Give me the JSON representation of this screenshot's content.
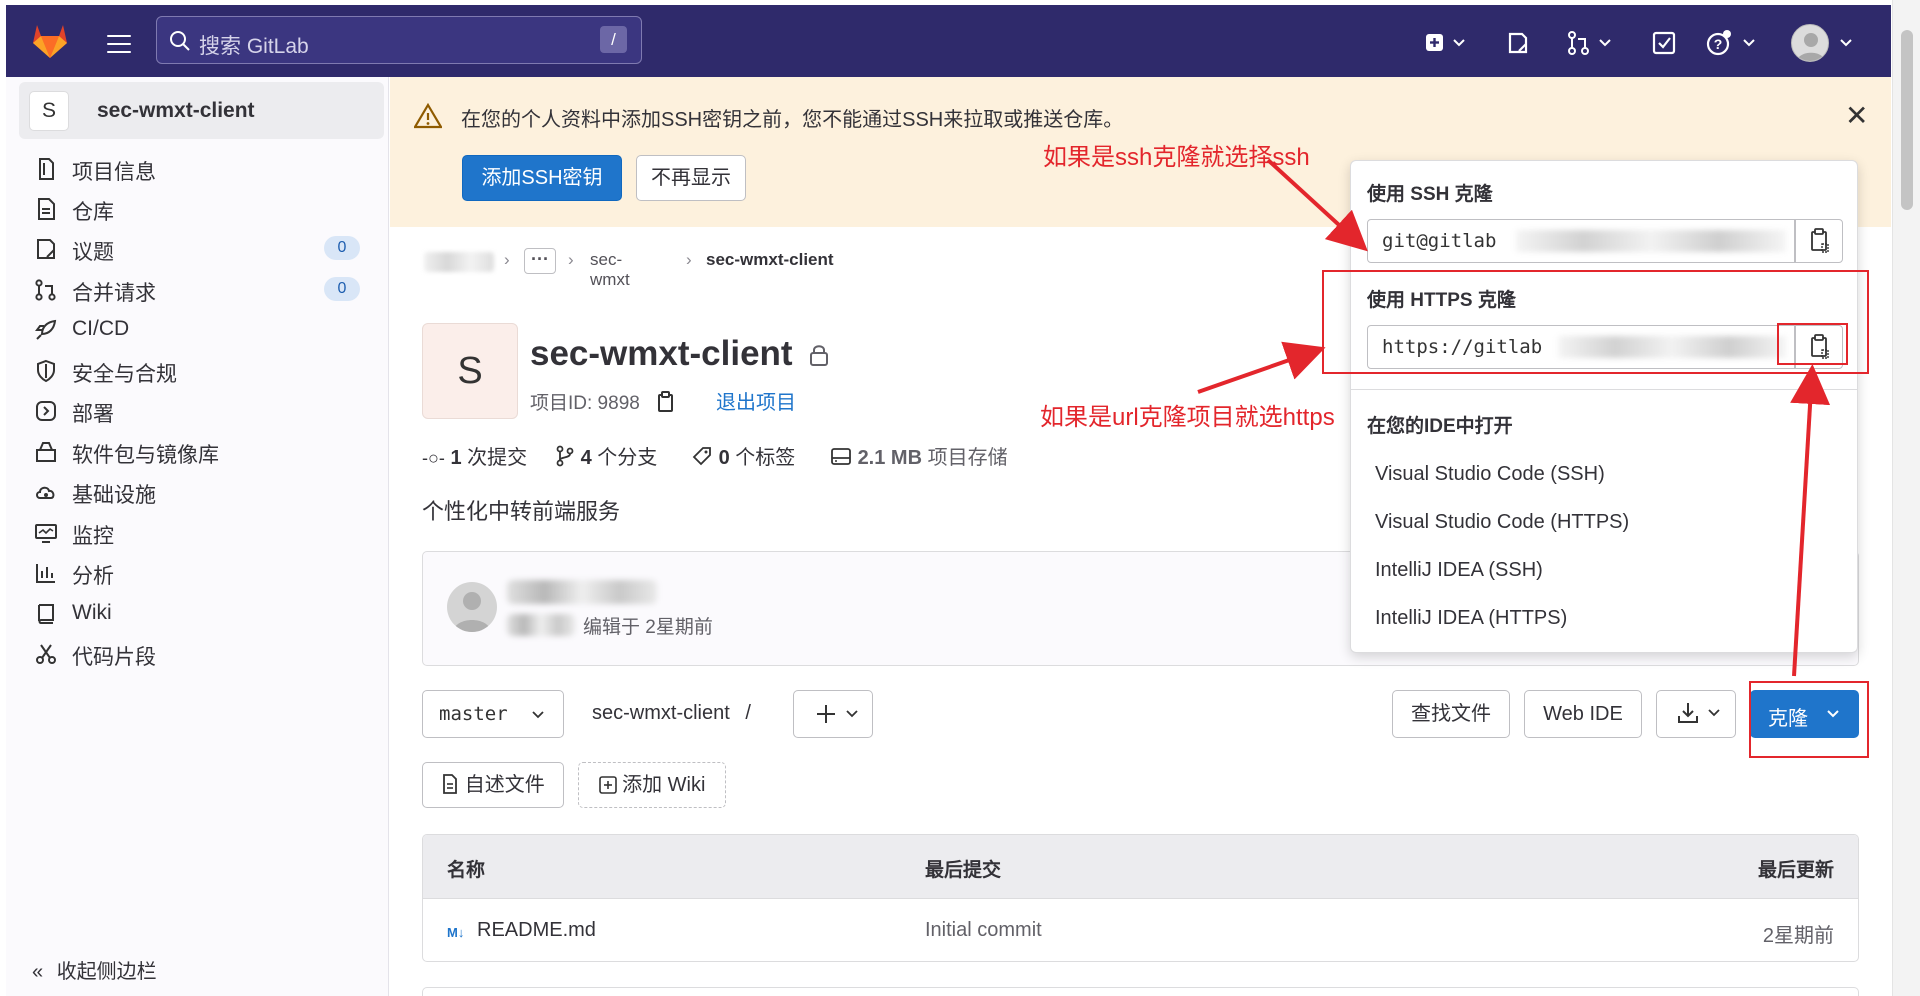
{
  "topbar": {
    "search_placeholder": "搜索 GitLab",
    "search_shortcut": "/"
  },
  "sidebar": {
    "project_initial": "S",
    "project_name": "sec-wmxt-client",
    "items": [
      {
        "label": "项目信息",
        "icon": "info-icon"
      },
      {
        "label": "仓库",
        "icon": "document-icon"
      },
      {
        "label": "议题",
        "icon": "issues-icon",
        "count": "0"
      },
      {
        "label": "合并请求",
        "icon": "merge-request-icon",
        "count": "0"
      },
      {
        "label": "CI/CD",
        "icon": "rocket-icon"
      },
      {
        "label": "安全与合规",
        "icon": "shield-icon"
      },
      {
        "label": "部署",
        "icon": "deployments-icon"
      },
      {
        "label": "软件包与镜像库",
        "icon": "package-icon"
      },
      {
        "label": "基础设施",
        "icon": "cloud-gear-icon"
      },
      {
        "label": "监控",
        "icon": "monitor-icon"
      },
      {
        "label": "分析",
        "icon": "chart-icon"
      },
      {
        "label": "Wiki",
        "icon": "book-icon"
      },
      {
        "label": "代码片段",
        "icon": "snippet-icon"
      }
    ],
    "collapse_label": "收起侧边栏"
  },
  "alert": {
    "message": "在您的个人资料中添加SSH密钥之前，您不能通过SSH来拉取或推送仓库。",
    "add_key_button": "添加SSH密钥",
    "dismiss_button": "不再显示"
  },
  "breadcrumb": {
    "items": [
      "sec-wmxt",
      "sec-wmxt-client"
    ]
  },
  "project": {
    "initial": "S",
    "title": "sec-wmxt-client",
    "id_label": "项目ID: 9898",
    "leave_label": "退出项目",
    "stats": {
      "commits_num": "1",
      "commits_label": "次提交",
      "branches_num": "4",
      "branches_label": "个分支",
      "tags_num": "0",
      "tags_label": "个标签",
      "storage_num": "2.1 MB",
      "storage_label": "项目存储"
    },
    "description": "个性化中转前端服务"
  },
  "commit": {
    "edited_label": "编辑于 2星期前"
  },
  "repo_bar": {
    "branch": "master",
    "path": "sec-wmxt-client",
    "path_sep": "/",
    "find_file": "查找文件",
    "web_ide": "Web IDE",
    "clone": "克隆",
    "readme": "自述文件",
    "add_wiki": "添加 Wiki"
  },
  "files_table": {
    "headers": [
      "名称",
      "最后提交",
      "最后更新"
    ],
    "rows": [
      {
        "name": "README.md",
        "commit": "Initial commit",
        "updated": "2星期前"
      }
    ]
  },
  "clone_dropdown": {
    "ssh_heading": "使用 SSH 克隆",
    "ssh_value": "git@gitlab",
    "https_heading": "使用 HTTPS 克隆",
    "https_value": "https://gitlab",
    "ide_heading": "在您的IDE中打开",
    "ide_items": [
      "Visual Studio Code (SSH)",
      "Visual Studio Code (HTTPS)",
      "IntelliJ IDEA (SSH)",
      "IntelliJ IDEA (HTTPS)"
    ]
  },
  "annotations": {
    "ssh_note": "如果是ssh克隆就选择ssh",
    "https_note": "如果是url克隆项目就选https"
  },
  "colors": {
    "topbar": "#2f2a6b",
    "primary": "#1f75cb",
    "alert_bg": "#fdf1dd",
    "annotation_red": "#e3262c"
  }
}
